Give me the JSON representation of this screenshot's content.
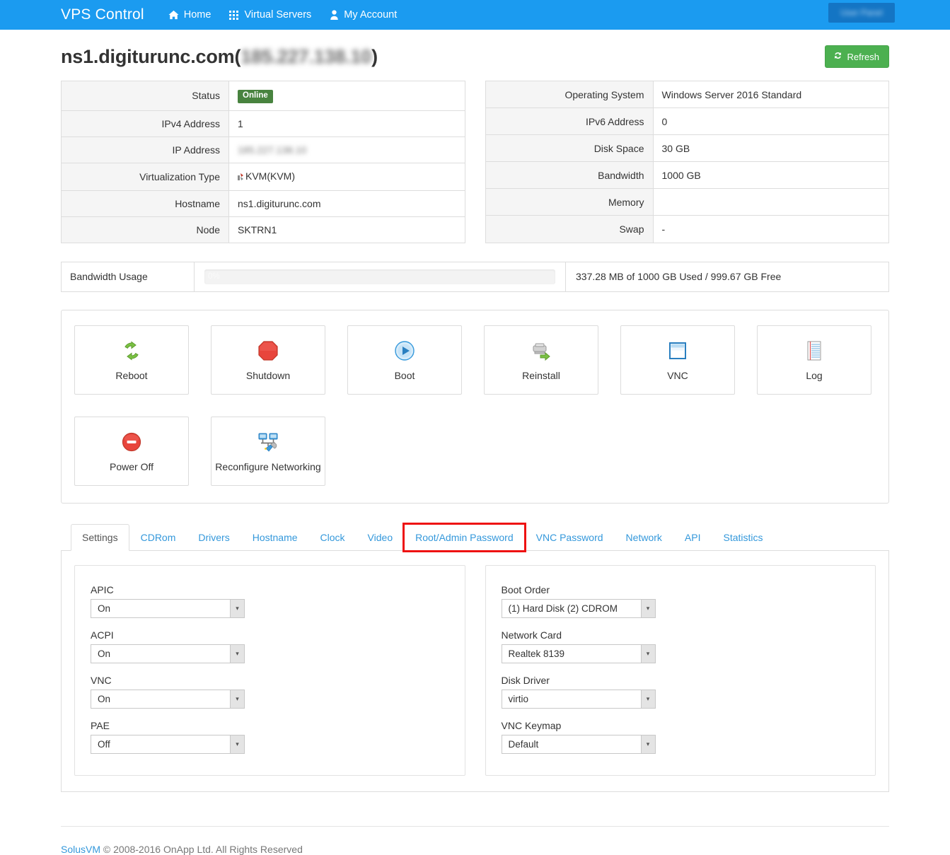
{
  "navbar": {
    "brand": "VPS Control",
    "links": [
      {
        "label": "Home",
        "icon": "home-icon"
      },
      {
        "label": "Virtual Servers",
        "icon": "grid-icon"
      },
      {
        "label": "My Account",
        "icon": "user-icon"
      }
    ],
    "account_button_label": "User Panel",
    "background_color": "#1b9bf0"
  },
  "page": {
    "title_host": "ns1.digiturunc.com",
    "title_open_paren": "(",
    "title_ip_masked": "185.227.138.10",
    "title_close_paren": ")",
    "refresh_label": "Refresh",
    "refresh_color": "#4cb050"
  },
  "info_left": {
    "rows": [
      {
        "label": "Status",
        "value": "Online",
        "type": "badge"
      },
      {
        "label": "IPv4 Address",
        "value": "1",
        "type": "text"
      },
      {
        "label": "IP Address",
        "value": "185.227.138.10",
        "type": "blurred"
      },
      {
        "label": "Virtualization Type",
        "value": "KVM(KVM)",
        "type": "icon-text"
      },
      {
        "label": "Hostname",
        "value": "ns1.digiturunc.com",
        "type": "text"
      },
      {
        "label": "Node",
        "value": "SKTRN1",
        "type": "text"
      }
    ]
  },
  "info_right": {
    "rows": [
      {
        "label": "Operating System",
        "value": "Windows Server 2016 Standard"
      },
      {
        "label": "IPv6 Address",
        "value": "0"
      },
      {
        "label": "Disk Space",
        "value": "30 GB"
      },
      {
        "label": "Bandwidth",
        "value": "1000 GB"
      },
      {
        "label": "Memory",
        "value": ""
      },
      {
        "label": "Swap",
        "value": "-"
      }
    ]
  },
  "bandwidth": {
    "label": "Bandwidth Usage",
    "percent_text": "0%",
    "percent_value": 0,
    "summary": "337.28 MB of 1000 GB Used / 999.67 GB Free"
  },
  "actions": [
    {
      "label": "Reboot",
      "icon": "reboot-icon"
    },
    {
      "label": "Shutdown",
      "icon": "shutdown-icon"
    },
    {
      "label": "Boot",
      "icon": "boot-icon"
    },
    {
      "label": "Reinstall",
      "icon": "reinstall-icon"
    },
    {
      "label": "VNC",
      "icon": "vnc-icon"
    },
    {
      "label": "Log",
      "icon": "log-icon"
    },
    {
      "label": "Power Off",
      "icon": "power-off-icon"
    },
    {
      "label": "Reconfigure Networking",
      "icon": "network-config-icon"
    }
  ],
  "tabs": [
    {
      "label": "Settings",
      "active": true,
      "highlighted": false
    },
    {
      "label": "CDRom",
      "active": false,
      "highlighted": false
    },
    {
      "label": "Drivers",
      "active": false,
      "highlighted": false
    },
    {
      "label": "Hostname",
      "active": false,
      "highlighted": false
    },
    {
      "label": "Clock",
      "active": false,
      "highlighted": false
    },
    {
      "label": "Video",
      "active": false,
      "highlighted": false
    },
    {
      "label": "Root/Admin Password",
      "active": false,
      "highlighted": true
    },
    {
      "label": "VNC Password",
      "active": false,
      "highlighted": false
    },
    {
      "label": "Network",
      "active": false,
      "highlighted": false
    },
    {
      "label": "API",
      "active": false,
      "highlighted": false
    },
    {
      "label": "Statistics",
      "active": false,
      "highlighted": false
    }
  ],
  "highlight_color": "#ee1111",
  "settings_left": [
    {
      "label": "APIC",
      "value": "On"
    },
    {
      "label": "ACPI",
      "value": "On"
    },
    {
      "label": "VNC",
      "value": "On"
    },
    {
      "label": "PAE",
      "value": "Off"
    }
  ],
  "settings_right": [
    {
      "label": "Boot Order",
      "value": "(1) Hard Disk (2) CDROM"
    },
    {
      "label": "Network Card",
      "value": "Realtek 8139"
    },
    {
      "label": "Disk Driver",
      "value": "virtio"
    },
    {
      "label": "VNC Keymap",
      "value": "Default"
    }
  ],
  "footer": {
    "link": "SolusVM",
    "text": " © 2008-2016 OnApp Ltd. All Rights Reserved"
  }
}
